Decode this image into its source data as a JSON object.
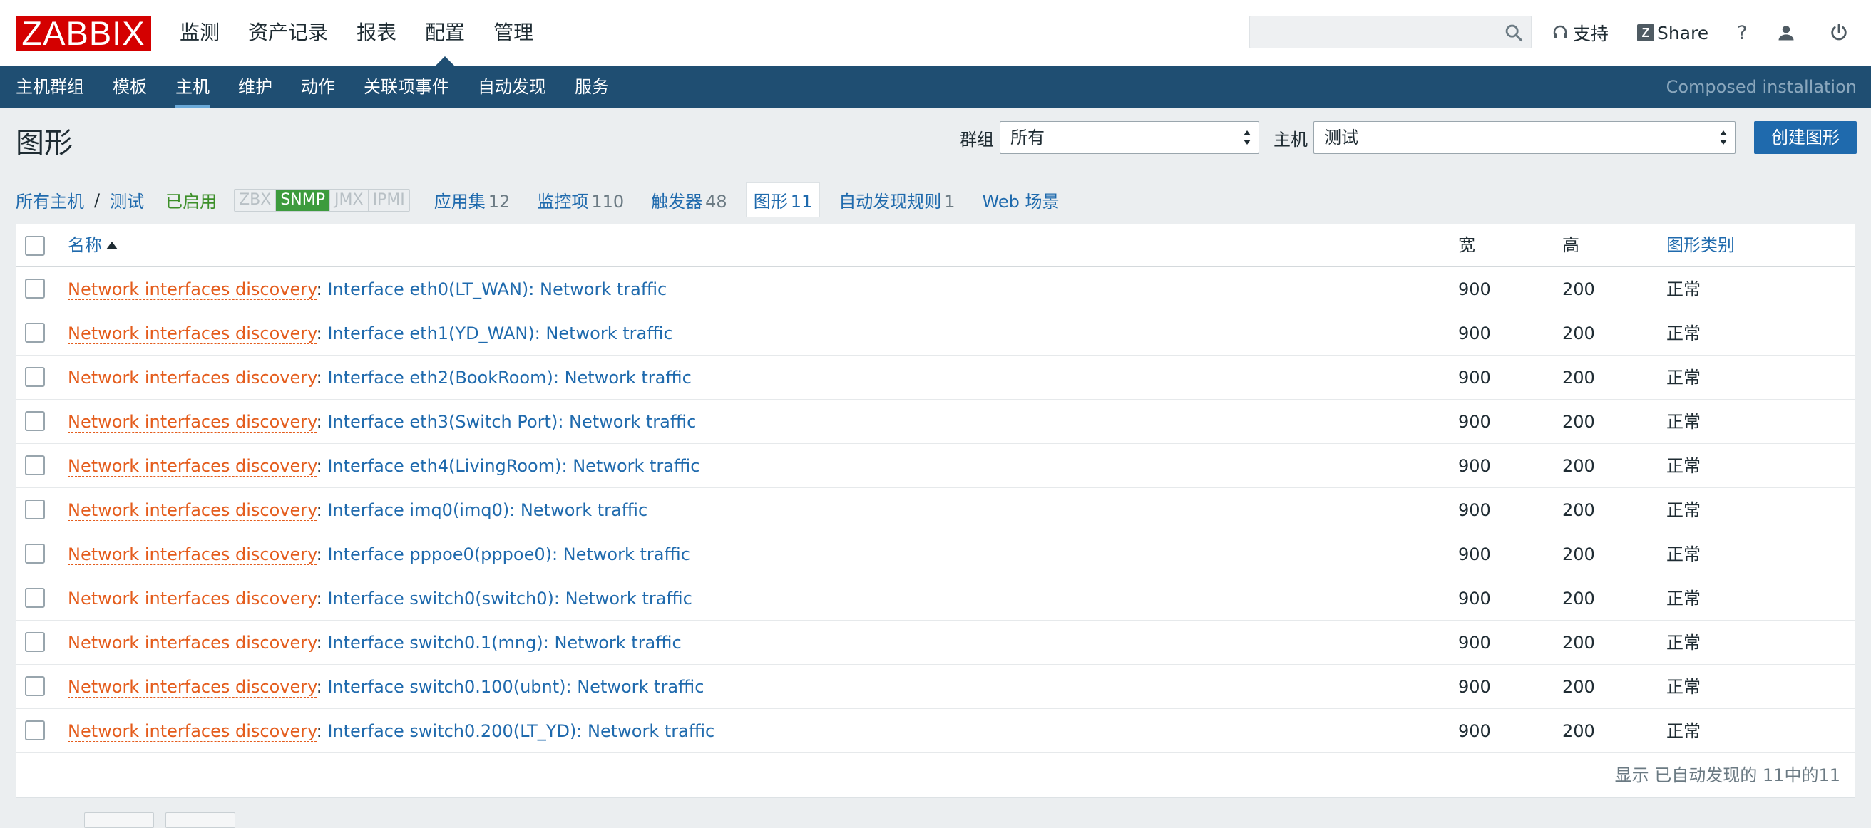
{
  "logo": "ZABBIX",
  "main_menu": [
    {
      "label": "监测",
      "active": false
    },
    {
      "label": "资产记录",
      "active": false
    },
    {
      "label": "报表",
      "active": false
    },
    {
      "label": "配置",
      "active": true
    },
    {
      "label": "管理",
      "active": false
    }
  ],
  "search": {
    "value": "",
    "placeholder": ""
  },
  "top_links": {
    "support": "支持",
    "share": "Share",
    "help": "?"
  },
  "sub_menu": [
    {
      "label": "主机群组",
      "active": false
    },
    {
      "label": "模板",
      "active": false
    },
    {
      "label": "主机",
      "active": true
    },
    {
      "label": "维护",
      "active": false
    },
    {
      "label": "动作",
      "active": false
    },
    {
      "label": "关联项事件",
      "active": false
    },
    {
      "label": "自动发现",
      "active": false
    },
    {
      "label": "服务",
      "active": false
    }
  ],
  "composed": "Composed installation",
  "page": {
    "title": "图形"
  },
  "filter": {
    "group_label": "群组",
    "group_value": "所有",
    "host_label": "主机",
    "host_value": "测试",
    "create_button": "创建图形"
  },
  "host_nav": {
    "all_hosts": "所有主机",
    "separator": "/",
    "host": "测试",
    "status": "已启用",
    "availability": [
      {
        "label": "ZBX",
        "on": false
      },
      {
        "label": "SNMP",
        "on": true
      },
      {
        "label": "JMX",
        "on": false
      },
      {
        "label": "IPMI",
        "on": false
      }
    ],
    "tabs": [
      {
        "label": "应用集",
        "count": "12",
        "active": false
      },
      {
        "label": "监控项",
        "count": "110",
        "active": false
      },
      {
        "label": "触发器",
        "count": "48",
        "active": false
      },
      {
        "label": "图形",
        "count": "11",
        "active": true
      },
      {
        "label": "自动发现规则",
        "count": "1",
        "active": false
      },
      {
        "label": "Web 场景",
        "count": "",
        "active": false
      }
    ]
  },
  "table": {
    "headers": {
      "name": "名称",
      "width": "宽",
      "height": "高",
      "type": "图形类别"
    },
    "rows": [
      {
        "prefix": "Network interfaces discovery",
        "name": "Interface eth0(LT_WAN): Network traffic",
        "width": "900",
        "height": "200",
        "type": "正常"
      },
      {
        "prefix": "Network interfaces discovery",
        "name": "Interface eth1(YD_WAN): Network traffic",
        "width": "900",
        "height": "200",
        "type": "正常"
      },
      {
        "prefix": "Network interfaces discovery",
        "name": "Interface eth2(BookRoom): Network traffic",
        "width": "900",
        "height": "200",
        "type": "正常"
      },
      {
        "prefix": "Network interfaces discovery",
        "name": "Interface eth3(Switch Port): Network traffic",
        "width": "900",
        "height": "200",
        "type": "正常"
      },
      {
        "prefix": "Network interfaces discovery",
        "name": "Interface eth4(LivingRoom): Network traffic",
        "width": "900",
        "height": "200",
        "type": "正常"
      },
      {
        "prefix": "Network interfaces discovery",
        "name": "Interface imq0(imq0): Network traffic",
        "width": "900",
        "height": "200",
        "type": "正常"
      },
      {
        "prefix": "Network interfaces discovery",
        "name": "Interface pppoe0(pppoe0): Network traffic",
        "width": "900",
        "height": "200",
        "type": "正常"
      },
      {
        "prefix": "Network interfaces discovery",
        "name": "Interface switch0(switch0): Network traffic",
        "width": "900",
        "height": "200",
        "type": "正常"
      },
      {
        "prefix": "Network interfaces discovery",
        "name": "Interface switch0.1(mng): Network traffic",
        "width": "900",
        "height": "200",
        "type": "正常"
      },
      {
        "prefix": "Network interfaces discovery",
        "name": "Interface switch0.100(ubnt): Network traffic",
        "width": "900",
        "height": "200",
        "type": "正常"
      },
      {
        "prefix": "Network interfaces discovery",
        "name": "Interface switch0.200(LT_YD): Network traffic",
        "width": "900",
        "height": "200",
        "type": "正常"
      }
    ],
    "footer": "显示 已自动发现的 11中的11"
  },
  "colors": {
    "brand": "#d40000",
    "nav": "#1f4e72",
    "link": "#1f6aad",
    "discovery": "#e45c1c",
    "enabled": "#3c8f29"
  }
}
